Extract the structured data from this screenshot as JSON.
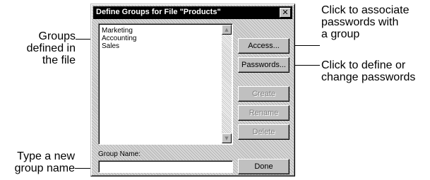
{
  "dialog": {
    "title": "Define Groups for File \"Products\"",
    "close_symbol": "✕",
    "groups": [
      "Marketing",
      "Accounting",
      "Sales"
    ],
    "buttons": {
      "access": "Access...",
      "passwords": "Passwords...",
      "create": "Create",
      "rename": "Rename",
      "delete": "Delete",
      "done": "Done"
    },
    "group_name_label": "Group Name:",
    "group_name_value": ""
  },
  "callouts": {
    "groups_defined": [
      "Groups",
      "defined in",
      "the file"
    ],
    "type_new_group": [
      "Type a new",
      "group name"
    ],
    "click_associate": [
      "Click to associate",
      "passwords with",
      "a group"
    ],
    "click_define": [
      "Click to define or",
      "change passwords"
    ]
  },
  "icons": {
    "close": "close-icon",
    "scroll_up": "scroll-up-arrow-icon",
    "scroll_down": "scroll-down-arrow-icon"
  }
}
